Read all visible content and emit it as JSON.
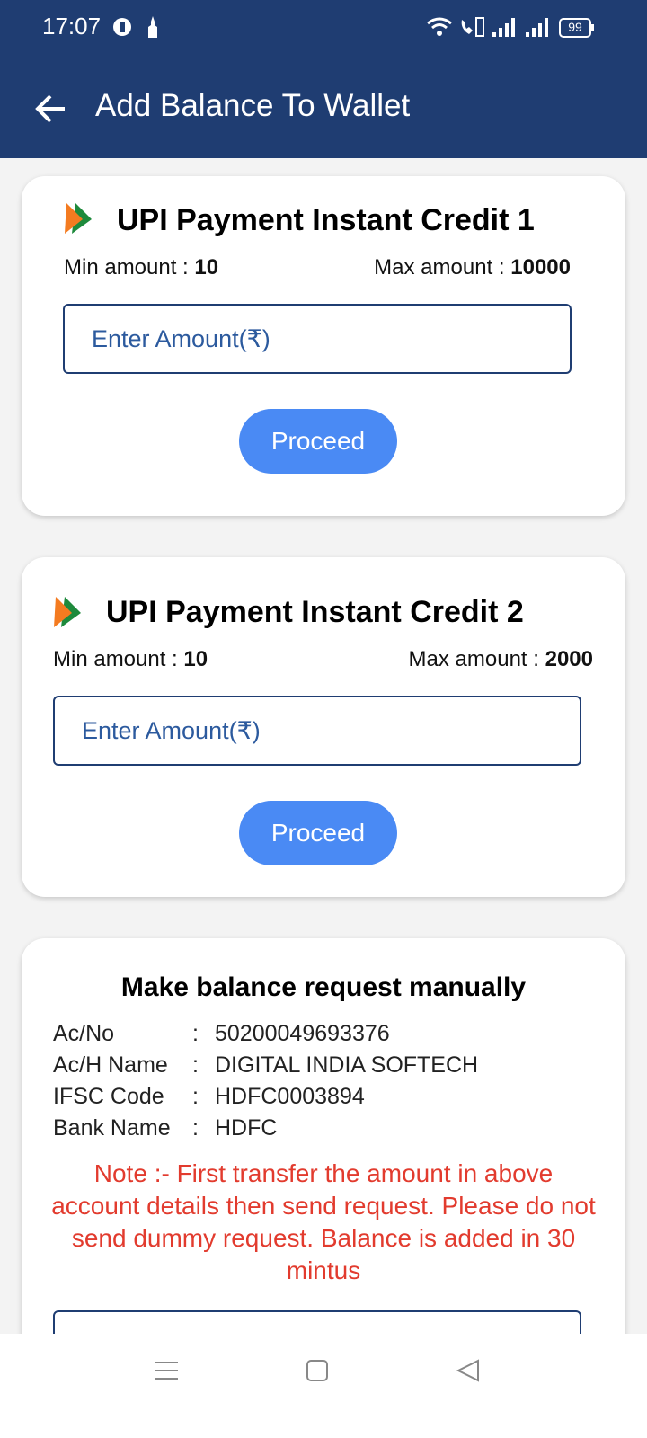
{
  "status_bar": {
    "time": "17:07",
    "battery": "99",
    "icons": [
      "vpn-key-icon",
      "notification-icon",
      "wifi-icon",
      "volte-icon",
      "signal-icon",
      "signal-icon",
      "battery-icon"
    ]
  },
  "app_bar": {
    "title": "Add Balance To Wallet",
    "back_icon": "arrow-left-icon"
  },
  "cards": [
    {
      "title": "UPI Payment Instant Credit 1",
      "min_label": "Min amount :",
      "min_value": "10",
      "max_label": "Max amount :",
      "max_value": "10000",
      "placeholder": "Enter Amount(₹)",
      "button": "Proceed"
    },
    {
      "title": "UPI Payment Instant Credit 2",
      "min_label": "Min amount :",
      "min_value": "10",
      "max_label": "Max amount :",
      "max_value": "2000",
      "placeholder": "Enter Amount(₹)",
      "button": "Proceed"
    }
  ],
  "manual": {
    "title": "Make balance request manually",
    "rows": [
      {
        "label": "Ac/No",
        "value": "50200049693376"
      },
      {
        "label": "Ac/H Name",
        "value": "DIGITAL INDIA SOFTECH"
      },
      {
        "label": "IFSC Code",
        "value": "HDFC0003894"
      },
      {
        "label": "Bank Name",
        "value": "HDFC"
      }
    ],
    "note": "Note :- First transfer the amount in above account details then send request. Please do not send dummy request. Balance is added in 30 mintus"
  },
  "colors": {
    "app_bar": "#1f3d72",
    "button": "#4a8af4",
    "note": "#e23b2e",
    "background": "#f3f3f3"
  },
  "nav_bar": [
    "menu-icon",
    "home-square-icon",
    "back-triangle-icon"
  ]
}
